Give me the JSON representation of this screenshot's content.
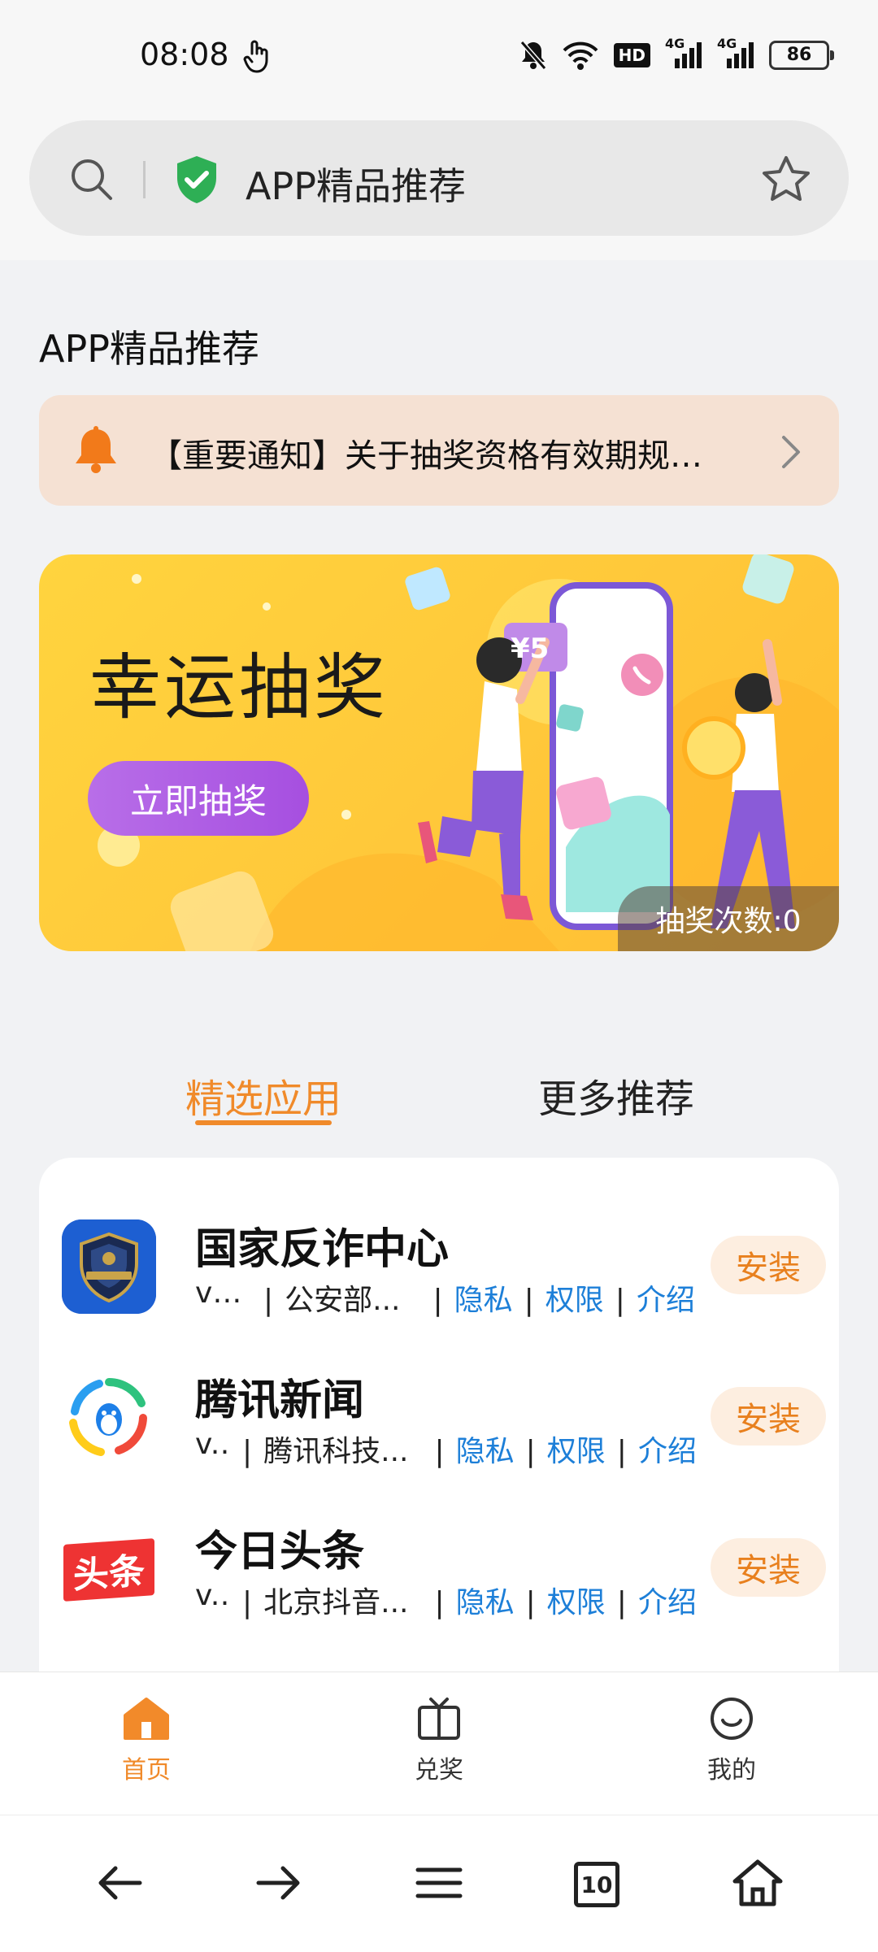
{
  "status_bar": {
    "time": "08:08",
    "battery": "86",
    "network_1": "4G",
    "network_2": "4G",
    "hd": "HD"
  },
  "url_bar": {
    "text": "APP精品推荐"
  },
  "page": {
    "title": "APP精品推荐",
    "notice": "【重要通知】关于抽奖资格有效期规则...",
    "banner": {
      "title": "幸运抽奖",
      "button": "立即抽奖",
      "price_tag": "¥5",
      "draw_count": "抽奖次数:0"
    },
    "tabs": [
      {
        "label": "精选应用",
        "active": true
      },
      {
        "label": "更多推荐",
        "active": false
      }
    ],
    "apps": [
      {
        "name": "国家反诈中心",
        "version": "v2...",
        "developer": "公安部...",
        "privacy": "隐私",
        "permissions": "权限",
        "intro": "介绍",
        "install": "安装",
        "icon": "anti-fraud-icon"
      },
      {
        "name": "腾讯新闻",
        "version": "v...",
        "developer": "腾讯科技...",
        "privacy": "隐私",
        "permissions": "权限",
        "intro": "介绍",
        "install": "安装",
        "icon": "tencent-news-icon"
      },
      {
        "name": "今日头条",
        "version": "v...",
        "developer": "北京抖音...",
        "privacy": "隐私",
        "permissions": "权限",
        "intro": "介绍",
        "install": "安装",
        "icon": "toutiao-icon",
        "icon_text": "头条"
      }
    ]
  },
  "bottom_nav": [
    {
      "label": "首页",
      "icon": "home-icon",
      "active": true
    },
    {
      "label": "兑奖",
      "icon": "tv-gift-icon",
      "active": false
    },
    {
      "label": "我的",
      "icon": "smile-icon",
      "active": false
    }
  ],
  "browser_bar": {
    "tab_count": "10"
  },
  "colors": {
    "accent": "#f08a2a",
    "link": "#1d7fd8",
    "banner": "#ffc83a",
    "button_purple": "#a64fe0"
  }
}
